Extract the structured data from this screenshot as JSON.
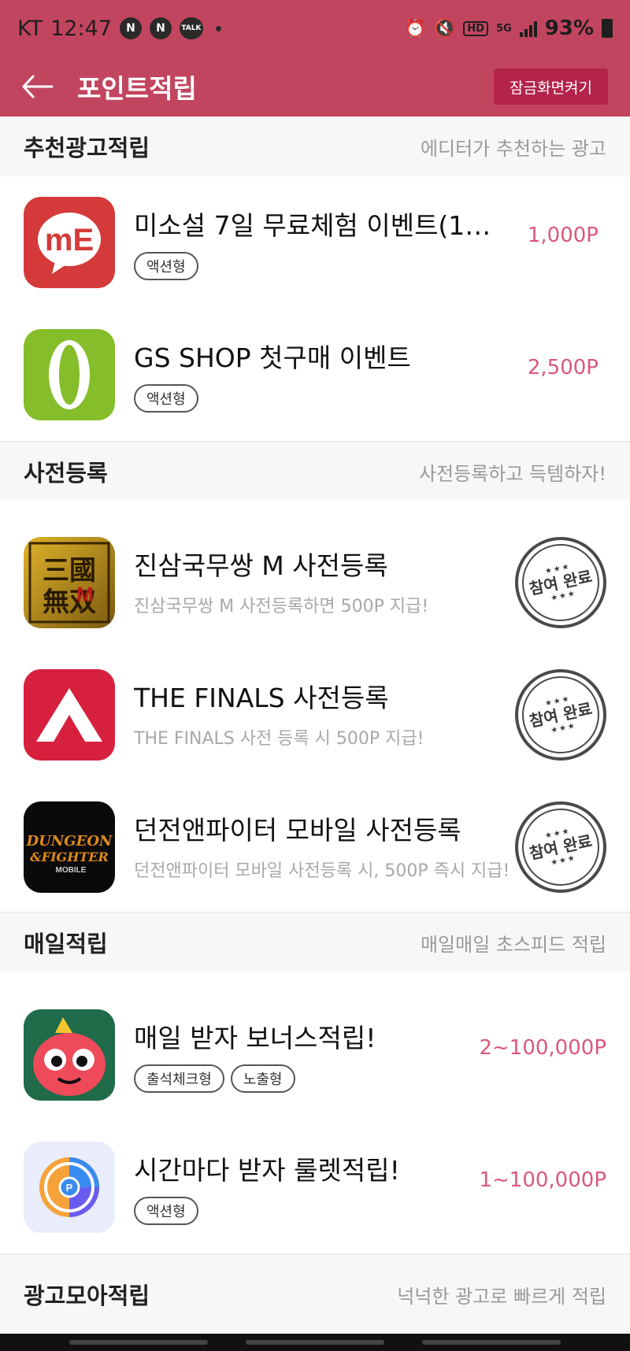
{
  "status_bar": {
    "carrier": "KT",
    "time": "12:47",
    "notif_badges": [
      "N",
      "N",
      "TALK"
    ],
    "hd_label": "HD",
    "network_label": "5G",
    "battery": "93%"
  },
  "app_bar": {
    "title": "포인트적립",
    "lock_button": "잠금화면켜기"
  },
  "sections": [
    {
      "title": "추천광고적립",
      "subtitle": "에디터가 추천하는 광고",
      "items": [
        {
          "title": "미소설 7일 무료체험 이벤트(19…",
          "tags": [
            "액션형"
          ],
          "points": "1,000P",
          "icon": "me-app-icon"
        },
        {
          "title": "GS SHOP 첫구매 이벤트",
          "tags": [
            "액션형"
          ],
          "points": "2,500P",
          "icon": "gs-shop-icon"
        }
      ]
    },
    {
      "title": "사전등록",
      "subtitle": "사전등록하고 득템하자!",
      "items": [
        {
          "title": "진삼국무쌍 M 사전등록",
          "desc": "진삼국무쌍 M 사전등록하면 500P 지급!",
          "stamp": "참여 완료",
          "icon": "dynasty-warriors-icon"
        },
        {
          "title": "THE FINALS 사전등록",
          "desc": "THE FINALS 사전 등록 시 500P 지급!",
          "stamp": "참여 완료",
          "icon": "the-finals-icon"
        },
        {
          "title": "던전앤파이터 모바일 사전등록",
          "desc": "던전앤파이터 모바일 사전등록 시, 500P 즉시 지급!",
          "stamp": "참여 완료",
          "icon": "dnf-mobile-icon"
        }
      ]
    },
    {
      "title": "매일적립",
      "subtitle": "매일매일 초스피드 적립",
      "items": [
        {
          "title": "매일 받자 보너스적립!",
          "tags": [
            "출석체크형",
            "노출형"
          ],
          "points": "2~100,000P",
          "icon": "bonus-monster-icon"
        },
        {
          "title": "시간마다 받자 룰렛적립!",
          "tags": [
            "액션형"
          ],
          "points": "1~100,000P",
          "icon": "roulette-icon"
        }
      ]
    },
    {
      "title": "광고모아적립",
      "subtitle": "넉넉한 광고로 빠르게 적립",
      "items": []
    }
  ],
  "colors": {
    "header": "#c2455f",
    "lock_button": "#b3234a",
    "points": "#d9587a"
  }
}
